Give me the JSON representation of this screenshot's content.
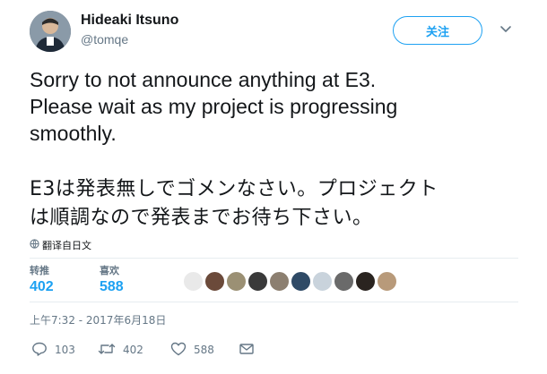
{
  "user": {
    "name": "Hideaki Itsuno",
    "handle": "@tomqe"
  },
  "follow_label": "关注",
  "tweet": {
    "lines_en": [
      "Sorry to not announce anything at E3.",
      "Please wait as my project is progressing",
      "smoothly."
    ],
    "lines_jp": [
      "E3は発表無しでゴメンなさい。プロジェクト",
      "は順調なので発表までお待ち下さい。"
    ]
  },
  "translate_label": "翻译自日文",
  "stats": {
    "retweets_label": "转推",
    "retweets_value": "402",
    "likes_label": "喜欢",
    "likes_value": "588"
  },
  "timestamp": "上午7:32 - 2017年6月18日",
  "actions": {
    "reply_count": "103",
    "retweet_count": "402",
    "like_count": "588"
  },
  "colors": {
    "accent": "#1da1f2",
    "secondary_text": "#657786"
  },
  "icons": [
    "caret-down-icon",
    "globe-icon",
    "reply-icon",
    "retweet-icon",
    "heart-icon",
    "envelope-icon"
  ]
}
